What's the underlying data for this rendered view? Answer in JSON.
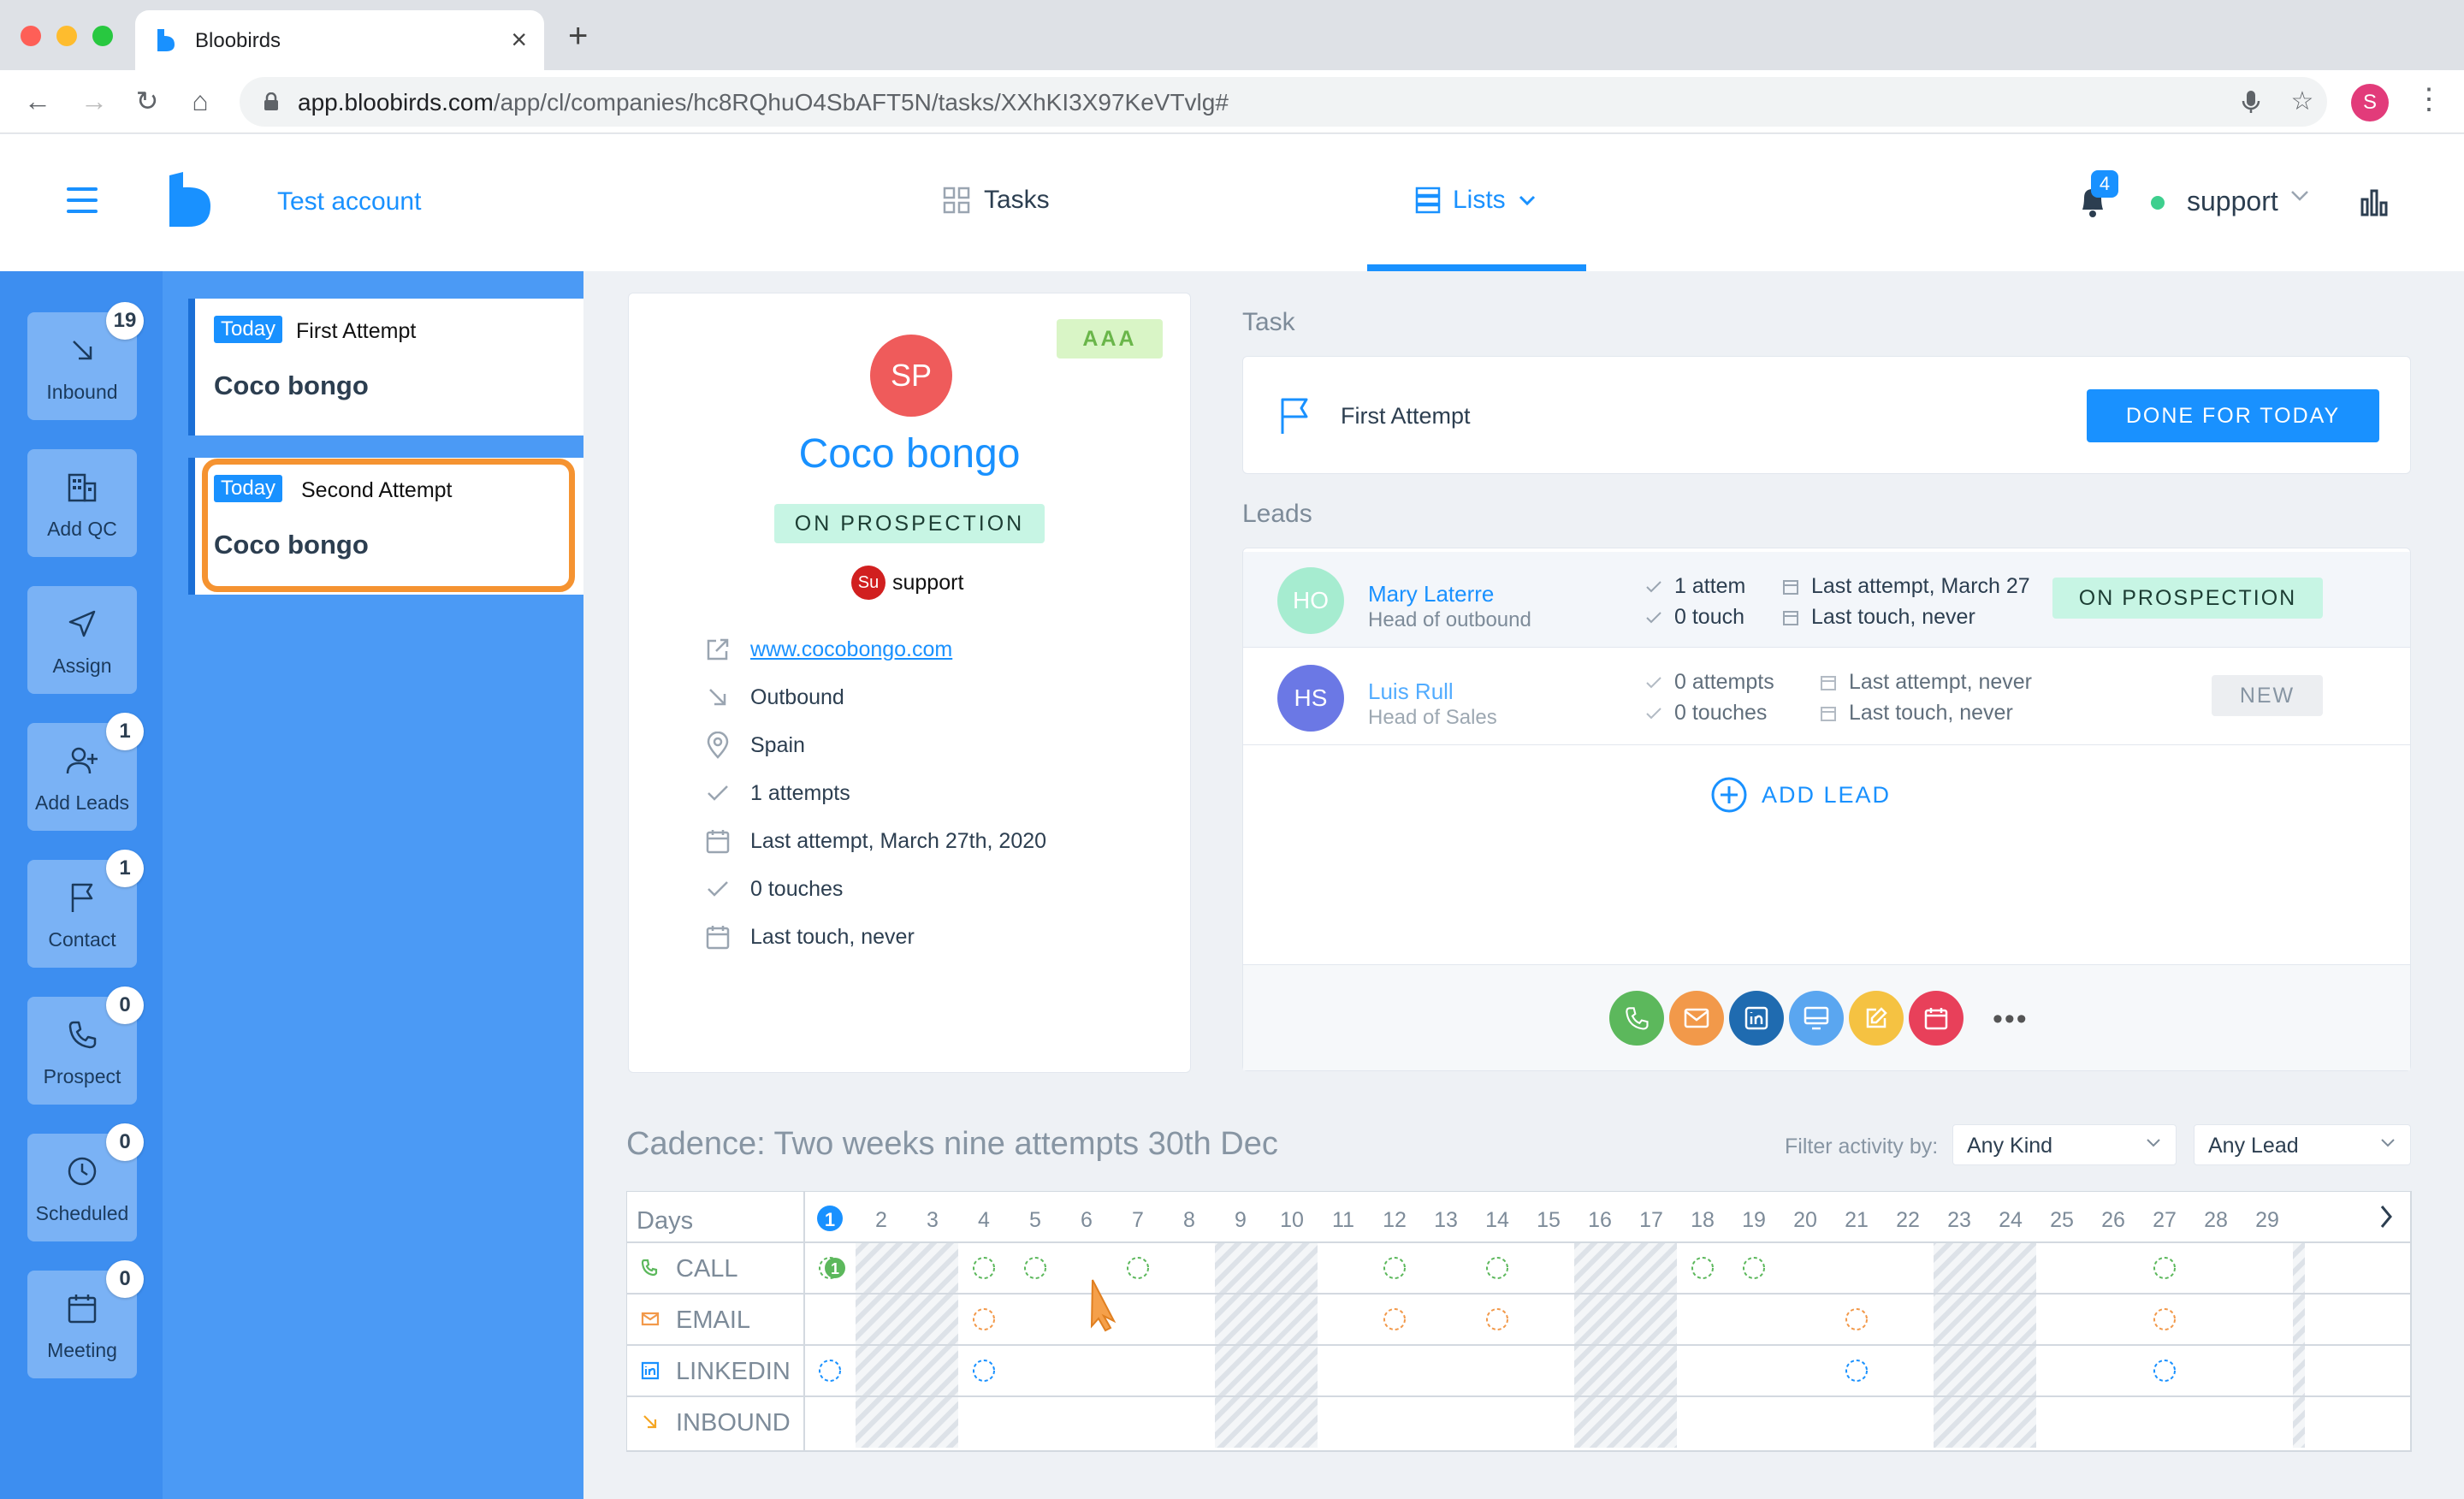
{
  "browser": {
    "tab_title": "Bloobirds",
    "url_host": "app.bloobirds.com",
    "url_path": "/app/cl/companies/hc8RQhuO4SbAFT5N/tasks/XXhKI3X97KeVTvlg#",
    "profile_initial": "S"
  },
  "header": {
    "account": "Test account",
    "nav_tasks": "Tasks",
    "nav_lists": "Lists",
    "notifications": "4",
    "user": "support"
  },
  "rail": [
    {
      "label": "Inbound",
      "badge": "19"
    },
    {
      "label": "Add QC",
      "badge": ""
    },
    {
      "label": "Assign",
      "badge": ""
    },
    {
      "label": "Add Leads",
      "badge": "1"
    },
    {
      "label": "Contact",
      "badge": "1"
    },
    {
      "label": "Prospect",
      "badge": "0"
    },
    {
      "label": "Scheduled",
      "badge": "0"
    },
    {
      "label": "Meeting",
      "badge": "0"
    }
  ],
  "tasks": [
    {
      "today": "Today",
      "attempt": "First Attempt",
      "company": "Coco bongo"
    },
    {
      "today": "Today",
      "attempt": "Second Attempt",
      "company": "Coco bongo"
    }
  ],
  "company": {
    "initials": "SP",
    "name": "Coco bongo",
    "rating": "AAA",
    "status": "ON PROSPECTION",
    "owner_initials": "Su",
    "owner": "support",
    "website": "www.cocobongo.com",
    "source": "Outbound",
    "country": "Spain",
    "attempts": "1 attempts",
    "last_attempt": "Last attempt, March 27th, 2020",
    "touches": "0 touches",
    "last_touch": "Last touch, never"
  },
  "task_panel": {
    "section": "Task",
    "name": "First Attempt",
    "done_button": "DONE FOR TODAY"
  },
  "leads": {
    "section": "Leads",
    "items": [
      {
        "initials": "HO",
        "name": "Mary Laterre",
        "title": "Head of outbound",
        "attempts": "1 attem",
        "touches": "0 touch",
        "last_attempt": "Last attempt, March 27",
        "last_touch": "Last touch, never",
        "status": "ON PROSPECTION"
      },
      {
        "initials": "HS",
        "name": "Luis Rull",
        "title": "Head of Sales",
        "attempts": "0 attempts",
        "touches": "0 touches",
        "last_attempt": "Last attempt, never",
        "last_touch": "Last touch, never",
        "status": "NEW"
      }
    ],
    "add_lead": "ADD LEAD"
  },
  "actions": [
    {
      "icon": "phone-icon",
      "color": "#5cb85c"
    },
    {
      "icon": "mail-icon",
      "color": "#f2994a"
    },
    {
      "icon": "linkedin-icon",
      "color": "#1f6bb0"
    },
    {
      "icon": "monitor-icon",
      "color": "#5aa6f0"
    },
    {
      "icon": "note-icon",
      "color": "#f5c242"
    },
    {
      "icon": "calendar-icon",
      "color": "#e8405a"
    }
  ],
  "cadence": {
    "title": "Cadence: Two weeks nine attempts 30th Dec",
    "filter_label": "Filter activity by:",
    "filter_kind": "Any Kind",
    "filter_lead": "Any Lead",
    "days_label": "Days",
    "days": [
      "1",
      "2",
      "3",
      "4",
      "5",
      "6",
      "7",
      "8",
      "9",
      "10",
      "11",
      "12",
      "13",
      "14",
      "15",
      "16",
      "17",
      "18",
      "19",
      "20",
      "21",
      "22",
      "23",
      "24",
      "25",
      "26",
      "27",
      "28",
      "29"
    ],
    "weekend_days": [
      2,
      3,
      9,
      10,
      16,
      17,
      23,
      24
    ],
    "rows": [
      {
        "label": "CALL",
        "color": "#5cb85c",
        "days": [
          1,
          4,
          5,
          7,
          12,
          14,
          18,
          19,
          27
        ],
        "done_day": 1,
        "done_count": "1"
      },
      {
        "label": "EMAIL",
        "color": "#f2994a",
        "days": [
          4,
          12,
          14,
          21,
          27
        ]
      },
      {
        "label": "LINKEDIN",
        "color": "#1991ff",
        "days": [
          1,
          4,
          21,
          27
        ]
      },
      {
        "label": "INBOUND",
        "color": "#f5a623",
        "days": []
      }
    ]
  }
}
